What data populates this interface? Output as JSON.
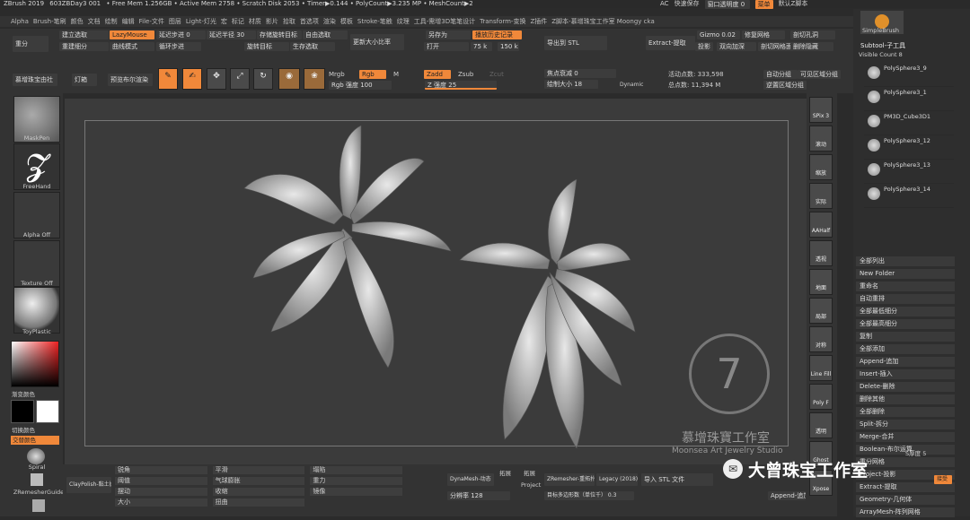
{
  "titlebar": {
    "app": "ZBrush 2019",
    "doc": "603ZBDay3 001",
    "stats": "• Free Mem 1.256GB • Active Mem 2758 • Scratch Disk 2053 • Timer▶0.144 • PolyCount▶3.235 MP • MeshCount▶2",
    "ac": "AC",
    "quicksave": "快速保存",
    "transparency": "窗口透明度 0",
    "menu": "菜单",
    "default": "默认Z脚本"
  },
  "menubar": [
    "Alpha",
    "Brush-笔刷",
    "颜色",
    "文档",
    "绘制",
    "编辑",
    "File-文件",
    "图层",
    "Light-灯光",
    "宏",
    "标记",
    "材质",
    "影片",
    "拾取",
    "首选项",
    "渲染",
    "模板",
    "Stroke-笔触",
    "纹理",
    "工具-需增3D笔笔设计",
    "Transform-变换",
    "Z插件",
    "Z脚本-慕增珠宝工作室 Moongy cka"
  ],
  "toolbar": {
    "r1": [
      "重分",
      "建立选取",
      "LazyMouse",
      "延迟步进 0",
      "延迟半径 30",
      "存储旋转目标",
      "自由选取",
      "更新大小比率",
      "另存为",
      "播放历史记录",
      "导出到 STL",
      "Extract-提取",
      "Gizmo 0.02",
      "修复网格",
      "剖切孔洞"
    ],
    "r2": [
      "重建细分",
      "曲线模式",
      "循环步进",
      "旋转目标",
      "生存选取",
      "打开",
      "75 k",
      "150 k",
      "投影",
      "双向加深",
      "剖切网格面",
      "删除隐藏"
    ],
    "r3": [
      "慕增珠宝由社",
      "灯箱",
      "预览布尔渲染",
      "Edit",
      "绘制",
      "移动",
      "缩放",
      "旋转",
      "Mrgb",
      "Rgb",
      "M",
      "Zadd",
      "Zsub",
      "Zcut",
      "Rgb 强度 100",
      "Z 强度 25",
      "焦点衰减 0",
      "绘制大小 18",
      "Dynamic",
      "活动点数: 333,598",
      "总点数: 11,394 M",
      "自动分组",
      "可见区域分组",
      "逆置区域分组",
      "Rgb 强度"
    ]
  },
  "leftpanel": {
    "brush1": "MaskPen",
    "brush2": "FreeHand",
    "alpha": "Alpha Off",
    "texture": "Texture Off",
    "material": "ToyPlastic",
    "gradient": "渐变颜色",
    "switch": "切换颜色",
    "alternate": "交替颜色",
    "spiral": "Spiral",
    "zremesh": "ZRemesherGuide"
  },
  "rightstrip": [
    "SPix 3",
    "滚动",
    "缩放",
    "实际",
    "AAHalf",
    "透视",
    "地面",
    "局部",
    "对称",
    "Line Fill",
    "Poly F",
    "透明",
    "Ghost",
    "Xpose"
  ],
  "subtool": {
    "header": "SimpleBrush",
    "title": "Subtool-子工具",
    "visible": "Visible Count 8",
    "items": [
      "PolySphere3_9",
      "PolySphere3_1",
      "PM3D_Cube3D1",
      "PolySphere3_12",
      "PolySphere3_13",
      "PolySphere3_14"
    ],
    "buttons": [
      "全部列出",
      "New Folder",
      "重命名",
      "自动重排",
      "全部最低细分",
      "全部最高细分",
      "复制",
      "全部添加",
      "Append-追加",
      "Insert-插入",
      "Delete-删除",
      "删除其他",
      "全部删除",
      "Split-拆分",
      "Merge-合并",
      "Boolean-布尔运算",
      "重分网格",
      "Project-投影",
      "Extract-提取",
      "Geometry-几何体",
      "ArrayMesh-阵列网格"
    ],
    "thickness": "S厚度 5",
    "accept": "接受"
  },
  "bottombar": {
    "clay": "ClayPolish-黏土抛光",
    "sliders": [
      "锐角",
      "平滑",
      "塌陷",
      "阈值",
      "气球膨胀",
      "重力",
      "摆动",
      "收缩",
      "镜像",
      "大小",
      "扭曲"
    ],
    "dyna": "DynaMesh-动态",
    "res": "分辨率 128",
    "zremesh": "ZRemesher-重拓扑",
    "legacy": "Legacy (2018)",
    "target": "目标多边形数（单位千） 0.3",
    "import": "导入 STL 文件",
    "append": "Append-追加",
    "proj": "Project",
    "exp": "拓展",
    "reserve": "拓展"
  },
  "watermark": {
    "studio": "慕增珠寶工作室",
    "studio_en": "Moonsea Art Jewelry Studio",
    "wechat": "大曾珠宝工作室",
    "seal": "7"
  },
  "colors": {
    "accent": "#f0883a",
    "bg": "#2b2b2b",
    "canvas": "#3a3a3a"
  }
}
